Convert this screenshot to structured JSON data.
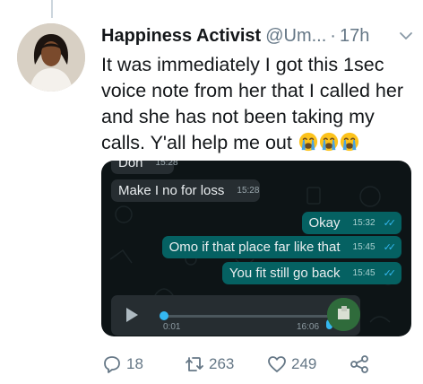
{
  "tweet": {
    "author_name": "Happiness Activist",
    "handle": "@Um...",
    "separator": "·",
    "time": "17h",
    "text": "It was immediately I got this  1sec voice note from her that I called her and she has not been taking my calls. Y'all help me out",
    "emoji": [
      "crying-face",
      "crying-face",
      "crying-face"
    ]
  },
  "media": {
    "messages": [
      {
        "dir": "in",
        "text": "Don",
        "time": "15:28"
      },
      {
        "dir": "in",
        "text": "Make I no for loss",
        "time": "15:28"
      },
      {
        "dir": "out",
        "text": "Okay",
        "time": "15:32"
      },
      {
        "dir": "out",
        "text": "Omo if that place far like that",
        "time": "15:45"
      },
      {
        "dir": "out",
        "text": "You fit still go back",
        "time": "15:45"
      }
    ],
    "voice_note": {
      "position": "0:01",
      "duration": "16:06"
    },
    "read_ticks": "✓✓"
  },
  "actions": {
    "replies": "18",
    "retweets": "263",
    "likes": "249"
  },
  "colors": {
    "tweet_text": "#14171a",
    "muted": "#657786",
    "whatsapp_bg": "#0d1416",
    "incoming_bubble": "#262d31",
    "outgoing_bubble": "#056162",
    "tick_blue": "#34b7f1"
  }
}
